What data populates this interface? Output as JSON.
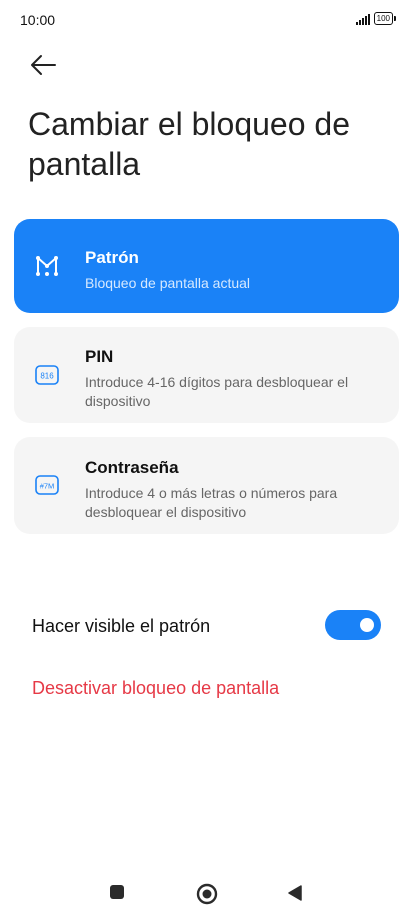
{
  "status_bar": {
    "time": "10:00",
    "battery": "100"
  },
  "page": {
    "title": "Cambiar el bloqueo de pantalla"
  },
  "options": [
    {
      "title": "Patrón",
      "subtitle": "Bloqueo de pantalla actual",
      "icon": "pattern-icon",
      "selected": true
    },
    {
      "title": "PIN",
      "subtitle": "Introduce 4-16 dígitos para desbloquear el dispositivo",
      "icon": "pin-icon",
      "icon_text": "816",
      "selected": false
    },
    {
      "title": "Contraseña",
      "subtitle": "Introduce 4 o más letras o números para desbloquear el dispositivo",
      "icon": "password-icon",
      "icon_text": "#7M",
      "selected": false
    }
  ],
  "settings": {
    "visible_pattern_label": "Hacer visible el patrón",
    "visible_pattern_enabled": true,
    "disable_label": "Desactivar bloqueo de pantalla"
  },
  "colors": {
    "accent": "#1a82f7",
    "danger": "#e63946",
    "card_bg": "#f5f5f5"
  }
}
